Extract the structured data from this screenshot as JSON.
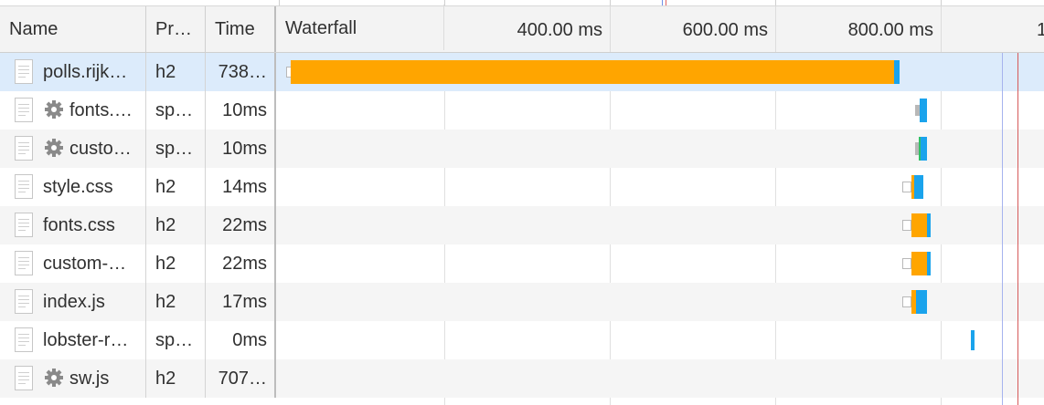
{
  "columns": {
    "name": "Name",
    "protocol": "Pr…",
    "time": "Time",
    "waterfall": "Waterfall"
  },
  "timeline_markers": [
    "400.00 ms",
    "600.00 ms",
    "800.00 ms"
  ],
  "requests": [
    {
      "name": "polls.rijk…",
      "protocol": "h2",
      "time": "738…",
      "icon": "document-icon",
      "gear": false,
      "selected": true
    },
    {
      "name": "fonts.…",
      "protocol": "sp…",
      "time": "10ms",
      "icon": "document-icon",
      "gear": true,
      "selected": false
    },
    {
      "name": "custo…",
      "protocol": "sp…",
      "time": "10ms",
      "icon": "document-icon",
      "gear": true,
      "selected": false
    },
    {
      "name": "style.css",
      "protocol": "h2",
      "time": "14ms",
      "icon": "document-icon",
      "gear": false,
      "selected": false
    },
    {
      "name": "fonts.css",
      "protocol": "h2",
      "time": "22ms",
      "icon": "document-icon",
      "gear": false,
      "selected": false
    },
    {
      "name": "custom-…",
      "protocol": "h2",
      "time": "22ms",
      "icon": "document-icon",
      "gear": false,
      "selected": false
    },
    {
      "name": "index.js",
      "protocol": "h2",
      "time": "17ms",
      "icon": "document-icon",
      "gear": false,
      "selected": false
    },
    {
      "name": "lobster-r…",
      "protocol": "sp…",
      "time": "0ms",
      "icon": "document-icon",
      "gear": false,
      "selected": false
    },
    {
      "name": "sw.js",
      "protocol": "h2",
      "time": "707…",
      "icon": "document-icon",
      "gear": true,
      "selected": false
    }
  ],
  "colors": {
    "waiting": "#ffa500",
    "download": "#1aa3ec",
    "selected_row": "#dcebfb",
    "dom_content_loaded_line": "#a6b3ee",
    "load_line": "#d65a5a"
  }
}
